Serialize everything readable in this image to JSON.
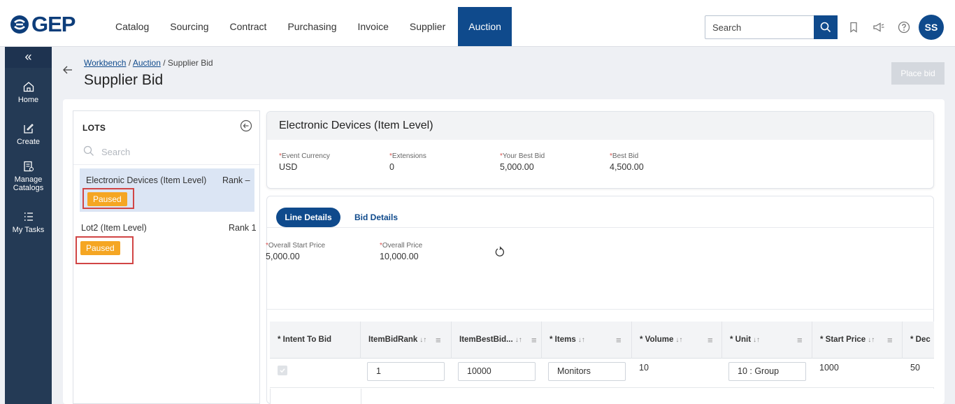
{
  "app": {
    "logo_text": "GEP",
    "brand_color": "#0f4a8c"
  },
  "nav": {
    "items": [
      {
        "label": "Catalog"
      },
      {
        "label": "Sourcing"
      },
      {
        "label": "Contract"
      },
      {
        "label": "Purchasing"
      },
      {
        "label": "Invoice"
      },
      {
        "label": "Supplier"
      },
      {
        "label": "Auction"
      }
    ],
    "active": "Auction"
  },
  "search": {
    "placeholder": "Search"
  },
  "user": {
    "initials": "SS"
  },
  "sidebar": {
    "collapse_icon": "double-chevron-left-icon",
    "items": [
      {
        "label": "Home",
        "icon": "home-icon"
      },
      {
        "label": "Create",
        "icon": "edit-icon"
      },
      {
        "label": "Manage Catalogs",
        "icon": "catalog-icon"
      },
      {
        "label": "My Tasks",
        "icon": "tasks-icon"
      }
    ]
  },
  "header": {
    "breadcrumb": {
      "workbench": "Workbench",
      "auction": "Auction",
      "current": "Supplier Bid"
    },
    "title": "Supplier Bid",
    "place_bid": "Place bid"
  },
  "lots": {
    "title": "LOTS",
    "search_placeholder": "Search",
    "items": [
      {
        "name": "Electronic Devices (Item Level)",
        "rank": "Rank –",
        "status": "Paused"
      },
      {
        "name": "Lot2 (Item Level)",
        "rank": "Rank 1",
        "status": "Paused"
      }
    ]
  },
  "lot_info": {
    "title": "Electronic Devices (Item Level)",
    "fields": [
      {
        "label": "Event Currency",
        "value": "USD"
      },
      {
        "label": "Extensions",
        "value": "0"
      },
      {
        "label": "Your Best Bid",
        "value": "5,000.00"
      },
      {
        "label": "Best Bid",
        "value": "4,500.00"
      }
    ]
  },
  "tabs": {
    "items": [
      {
        "label": "Line Details"
      },
      {
        "label": "Bid Details"
      }
    ],
    "active": "Line Details"
  },
  "line_summary": {
    "overall_start_price_label": "Overall Start Price",
    "overall_start_price": "5,000.00",
    "overall_price_label": "Overall Price",
    "overall_price": "10,000.00"
  },
  "table": {
    "columns": [
      {
        "label": "* Intent To Bid"
      },
      {
        "label": "ItemBidRank"
      },
      {
        "label": "ItemBestBid..."
      },
      {
        "label": "* Items"
      },
      {
        "label": "* Volume"
      },
      {
        "label": "* Unit"
      },
      {
        "label": "* Start Price"
      },
      {
        "label": "* Dec"
      }
    ],
    "rows": [
      {
        "intent_to_bid": true,
        "item_bid_rank": "1",
        "item_best_bid": "10000",
        "items": "Monitors",
        "volume": "10",
        "unit": "10 : Group",
        "start_price": "1000",
        "dec": "50"
      }
    ]
  }
}
